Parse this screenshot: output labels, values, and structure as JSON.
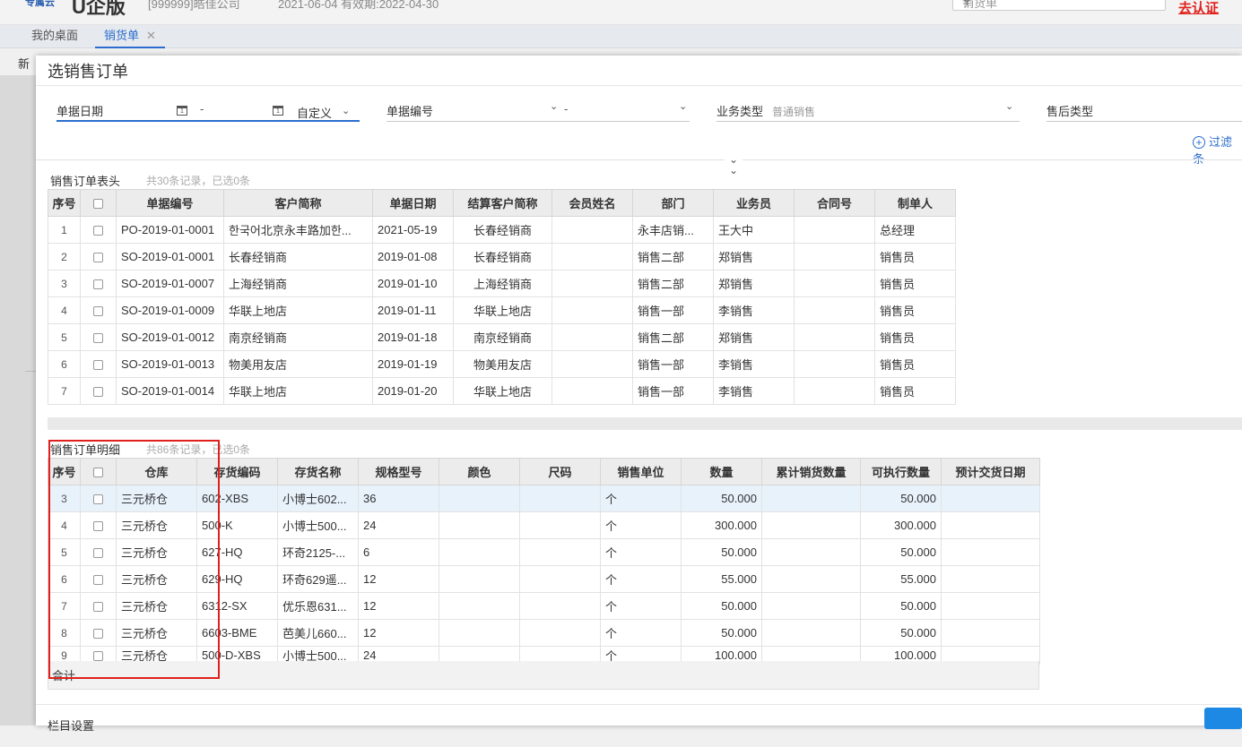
{
  "app": {
    "logo_small": "专属云",
    "logo_big": "U企版",
    "company": "[999999]皓佳公司",
    "date": "2021-06-04  有效期:2022-04-30",
    "search_text": "销货单",
    "cert_link": "去认证",
    "tabs": [
      "我的桌面",
      "销货单"
    ],
    "new_btn": "新"
  },
  "dialog": {
    "title": "选销售订单",
    "filters": {
      "date_label": "单据日期",
      "date_sep": "-",
      "custom": "自定义",
      "code_label": "单据编号",
      "code_sep": "-",
      "biz_label": "业务类型",
      "biz_value": "普通销售",
      "after_label": "售后类型",
      "more": "过滤条"
    },
    "header_section": {
      "title": "销售订单表头",
      "summary": "共30条记录，已选0条",
      "columns": [
        "序号",
        "",
        "单据编号",
        "客户简称",
        "单据日期",
        "结算客户简称",
        "会员姓名",
        "部门",
        "业务员",
        "合同号",
        "制单人"
      ],
      "rows": [
        {
          "seq": "1",
          "code": "PO-2019-01-0001",
          "customer": "한국어北京永丰路加한...",
          "date": "2021-05-19",
          "settle": "长春经销商",
          "member": "",
          "dept": "永丰店销...",
          "sales": "王大中",
          "contract": "",
          "maker": "总经理"
        },
        {
          "seq": "2",
          "code": "SO-2019-01-0001",
          "customer": "长春经销商",
          "date": "2019-01-08",
          "settle": "长春经销商",
          "member": "",
          "dept": "销售二部",
          "sales": "郑销售",
          "contract": "",
          "maker": "销售员"
        },
        {
          "seq": "3",
          "code": "SO-2019-01-0007",
          "customer": "上海经销商",
          "date": "2019-01-10",
          "settle": "上海经销商",
          "member": "",
          "dept": "销售二部",
          "sales": "郑销售",
          "contract": "",
          "maker": "销售员"
        },
        {
          "seq": "4",
          "code": "SO-2019-01-0009",
          "customer": "华联上地店",
          "date": "2019-01-11",
          "settle": "华联上地店",
          "member": "",
          "dept": "销售一部",
          "sales": "李销售",
          "contract": "",
          "maker": "销售员"
        },
        {
          "seq": "5",
          "code": "SO-2019-01-0012",
          "customer": "南京经销商",
          "date": "2019-01-18",
          "settle": "南京经销商",
          "member": "",
          "dept": "销售二部",
          "sales": "郑销售",
          "contract": "",
          "maker": "销售员"
        },
        {
          "seq": "6",
          "code": "SO-2019-01-0013",
          "customer": "物美用友店",
          "date": "2019-01-19",
          "settle": "物美用友店",
          "member": "",
          "dept": "销售一部",
          "sales": "李销售",
          "contract": "",
          "maker": "销售员"
        },
        {
          "seq": "7",
          "code": "SO-2019-01-0014",
          "customer": "华联上地店",
          "date": "2019-01-20",
          "settle": "华联上地店",
          "member": "",
          "dept": "销售一部",
          "sales": "李销售",
          "contract": "",
          "maker": "销售员"
        }
      ]
    },
    "detail_section": {
      "title": "销售订单明细",
      "summary": "共86条记录，已选0条",
      "columns": [
        "序号",
        "",
        "仓库",
        "存货编码",
        "存货名称",
        "规格型号",
        "颜色",
        "尺码",
        "销售单位",
        "数量",
        "累计销货数量",
        "可执行数量",
        "预计交货日期"
      ],
      "rows": [
        {
          "seq": "3",
          "wh": "三元桥仓",
          "code": "602-XBS",
          "name": "小博士602...",
          "spec": "36",
          "color": "",
          "size": "",
          "unit": "个",
          "qty": "50.000",
          "cum": "",
          "exec": "50.000",
          "due": ""
        },
        {
          "seq": "4",
          "wh": "三元桥仓",
          "code": "500-K",
          "name": "小博士500...",
          "spec": "24",
          "color": "",
          "size": "",
          "unit": "个",
          "qty": "300.000",
          "cum": "",
          "exec": "300.000",
          "due": ""
        },
        {
          "seq": "5",
          "wh": "三元桥仓",
          "code": "627-HQ",
          "name": "环奇2125-...",
          "spec": "6",
          "color": "",
          "size": "",
          "unit": "个",
          "qty": "50.000",
          "cum": "",
          "exec": "50.000",
          "due": ""
        },
        {
          "seq": "6",
          "wh": "三元桥仓",
          "code": "629-HQ",
          "name": "环奇629遥...",
          "spec": "12",
          "color": "",
          "size": "",
          "unit": "个",
          "qty": "55.000",
          "cum": "",
          "exec": "55.000",
          "due": ""
        },
        {
          "seq": "7",
          "wh": "三元桥仓",
          "code": "6312-SX",
          "name": "优乐恩631...",
          "spec": "12",
          "color": "",
          "size": "",
          "unit": "个",
          "qty": "50.000",
          "cum": "",
          "exec": "50.000",
          "due": ""
        },
        {
          "seq": "8",
          "wh": "三元桥仓",
          "code": "6603-BME",
          "name": "芭美儿660...",
          "spec": "12",
          "color": "",
          "size": "",
          "unit": "个",
          "qty": "50.000",
          "cum": "",
          "exec": "50.000",
          "due": ""
        },
        {
          "seq": "9",
          "wh": "三元桥仓",
          "code": "500-D-XBS",
          "name": "小博士500...",
          "spec": "24",
          "color": "",
          "size": "",
          "unit": "个",
          "qty": "100.000",
          "cum": "",
          "exec": "100.000",
          "due": ""
        }
      ],
      "total_label": "合计"
    },
    "footer": {
      "column_settings": "栏目设置"
    }
  }
}
